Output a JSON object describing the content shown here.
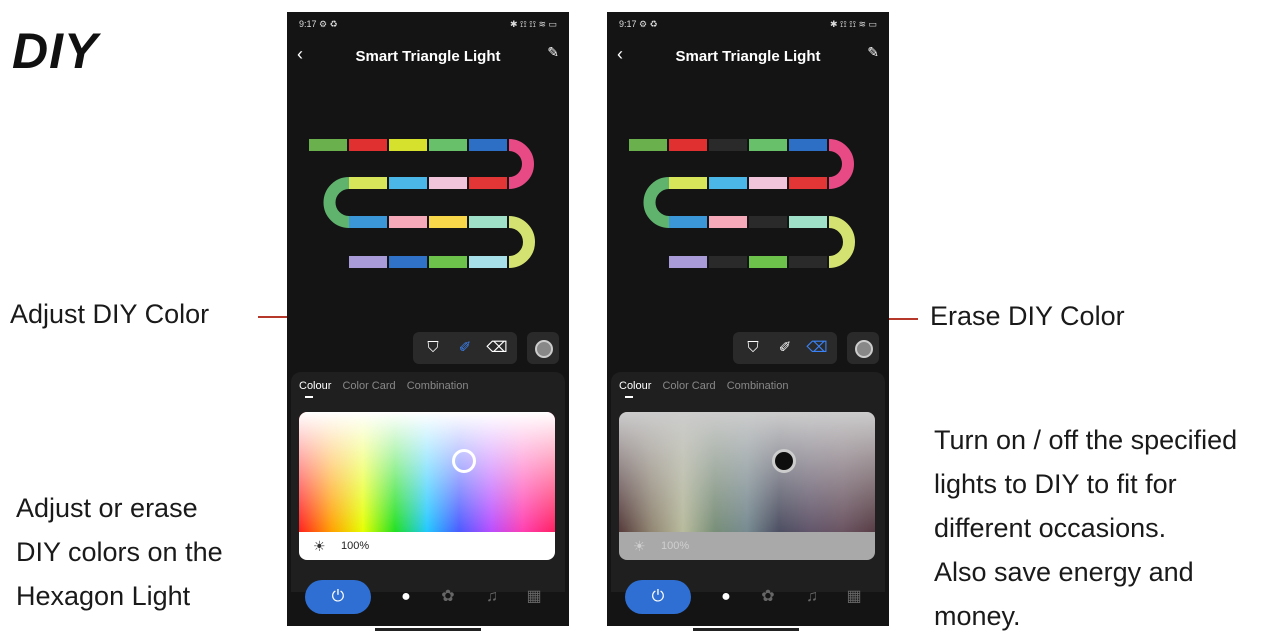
{
  "heading": "DIY",
  "annotations": {
    "adjust_color": "Adjust DIY Color",
    "erase_color": "Erase DIY Color",
    "left_desc": [
      "Adjust or erase",
      "DIY colors on the",
      "Hexagon Light"
    ],
    "right_desc": [
      "Turn on / off the specified",
      "lights to DIY to fit for",
      "different occasions.",
      "Also save energy and",
      "money."
    ]
  },
  "phones": [
    {
      "status_left": "9:17 ⚙ ♻",
      "status_right": "✱ ⟟⟟ ⟟⟟ ≋ ▭",
      "title": "Smart Triangle Light",
      "tabs": [
        "Colour",
        "Color Card",
        "Combination"
      ],
      "brightness": "100%",
      "active_tool": "brush",
      "tools": [
        "paint-bucket",
        "brush",
        "eraser"
      ],
      "nav": [
        "power",
        "bulb",
        "palette",
        "music",
        "grid"
      ],
      "segments": {
        "row1": [
          "#6ab04c",
          "#e03030",
          "#d6e12e",
          "#69c06a",
          "#2d6fc4"
        ],
        "row2": [
          "#d7e55a",
          "#4ab7e8",
          "#f2c4dc",
          "#e23535"
        ],
        "row3": [
          "#3c97d8",
          "#f5a9b9",
          "#f8d84a",
          "#9fe0c8"
        ],
        "row4": [
          "#a99ad8",
          "#2f72c8",
          "#6cc24a",
          "#a8e0ea"
        ],
        "caps": [
          "#e84a86",
          "#5fb36d",
          "#d3e270"
        ]
      }
    },
    {
      "status_left": "9:17 ⚙ ♻",
      "status_right": "✱ ⟟⟟ ⟟⟟ ≋ ▭",
      "title": "Smart Triangle Light",
      "tabs": [
        "Colour",
        "Color Card",
        "Combination"
      ],
      "brightness": "100%",
      "active_tool": "eraser",
      "tools": [
        "paint-bucket",
        "brush",
        "eraser"
      ],
      "nav": [
        "power",
        "bulb",
        "palette",
        "music",
        "grid"
      ],
      "segments": {
        "row1": [
          "#6ab04c",
          "#e03030",
          "#2a2a2a",
          "#69c06a",
          "#2d6fc4"
        ],
        "row2": [
          "#d7e55a",
          "#4ab7e8",
          "#f2c4dc",
          "#e23535"
        ],
        "row3": [
          "#3c97d8",
          "#f5a9b9",
          "#2a2a2a",
          "#9fe0c8"
        ],
        "row4": [
          "#a99ad8",
          "#2a2a2a",
          "#6cc24a",
          "#2a2a2a"
        ],
        "caps": [
          "#e84a86",
          "#5fb36d",
          "#d3e270"
        ]
      }
    }
  ]
}
